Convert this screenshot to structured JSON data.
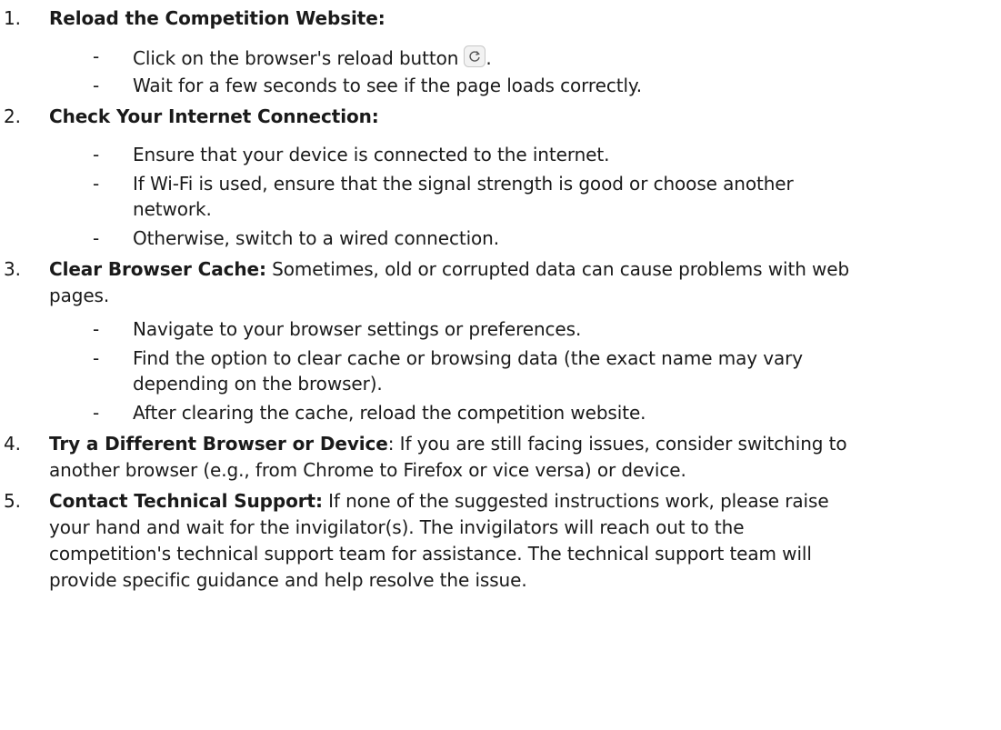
{
  "steps": [
    {
      "num": "1.",
      "title": "Reload the Competition Website:",
      "bullets": [
        "Click on the browser's reload button",
        "Wait for a few seconds to see if the page loads correctly."
      ],
      "bullet_suffix": "."
    },
    {
      "num": "2.",
      "title": "Check Your Internet Connection:",
      "bullets": [
        "Ensure that your device is connected to the internet.",
        "If Wi-Fi is used, ensure that the signal strength is good or choose another",
        "network.",
        "Otherwise, switch to a wired connection."
      ]
    },
    {
      "num": "3.",
      "title": "Clear Browser Cache:",
      "desc_line1": " Sometimes, old or corrupted data can cause problems with web",
      "desc_line2": "pages.",
      "bullets": [
        "Navigate to your browser settings or preferences.",
        "Find the option to clear cache or browsing data (the exact name may vary",
        "depending on the browser).",
        "After clearing the cache, reload the competition website."
      ]
    },
    {
      "num": "4.",
      "title": "Try a Different Browser or Device",
      "desc_line1": ": If you are still facing issues, consider switching to",
      "desc_line2": "another browser (e.g., from Chrome to Firefox or vice versa) or device."
    },
    {
      "num": "5.",
      "title": "Contact Technical Support:",
      "desc_line1": " If none of the suggested instructions work, please raise",
      "desc_line2": "your hand and wait for the invigilator(s). The invigilators will reach out to the",
      "desc_line3": "competition's technical support team for assistance. The technical support team will",
      "desc_line4": "provide specific guidance and help resolve the issue."
    }
  ],
  "dash": "-",
  "icons": {
    "reload": "reload-icon"
  }
}
